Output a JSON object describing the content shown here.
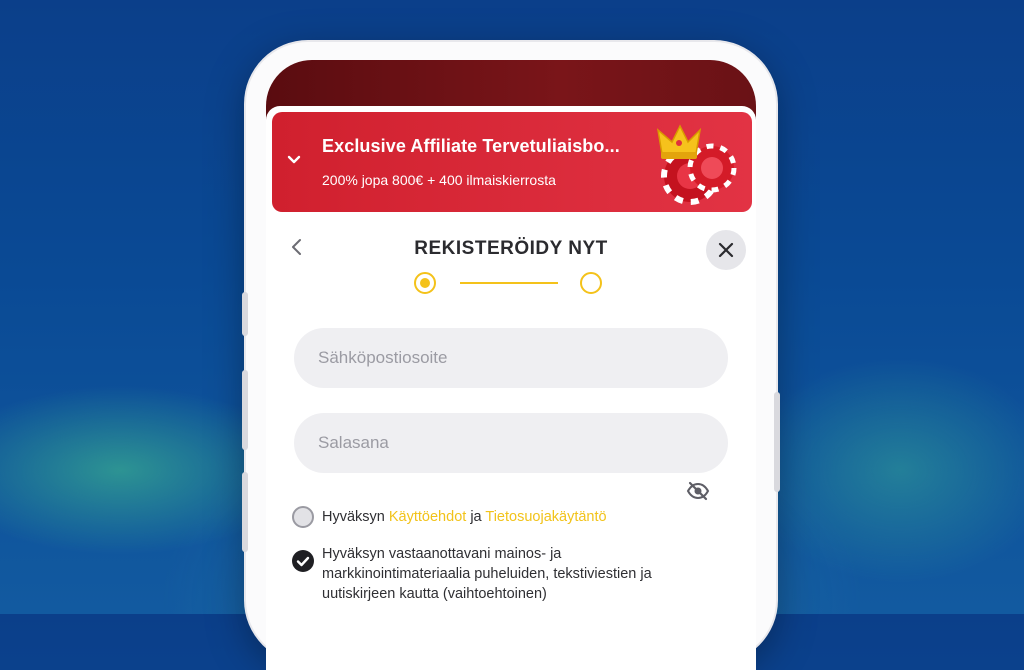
{
  "banner": {
    "title": "Exclusive Affiliate Tervetuliaisbo...",
    "subtitle": "200% jopa 800€ + 400 ilmaiskierrosta"
  },
  "header": {
    "title": "REKISTERÖIDY NYT"
  },
  "stepper": {
    "current_step": 1,
    "total_steps": 2
  },
  "form": {
    "email_placeholder": "Sähköpostiosoite",
    "password_placeholder": "Salasana"
  },
  "consents": {
    "terms": {
      "prefix": "Hyväksyn ",
      "terms_link": "Käyttöehdot",
      "joiner": " ja ",
      "privacy_link": "Tietosuojakäytäntö",
      "checked": false
    },
    "marketing": {
      "text": "Hyväksyn vastaanottavani mainos- ja markkinointimateriaalia puheluiden, tekstiviestien ja uutiskirjeen kautta (vaihtoehtoinen)",
      "checked": true
    }
  },
  "colors": {
    "accent": "#f4c21a",
    "banner": "#d0202e",
    "background": "#0b3f8a"
  }
}
